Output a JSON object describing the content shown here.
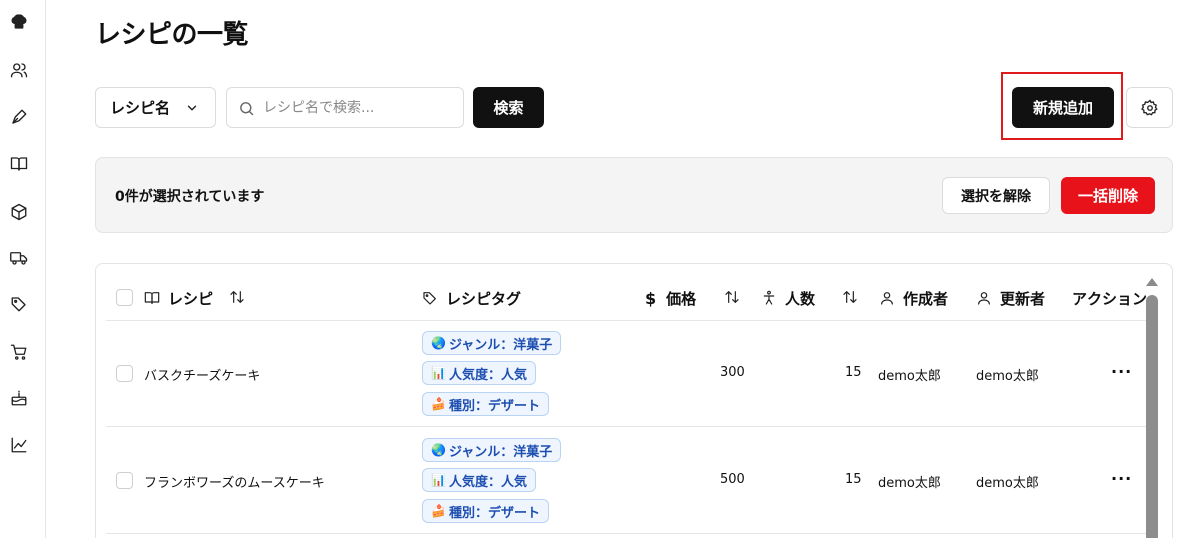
{
  "page": {
    "title": "レシピの一覧"
  },
  "sidebar": {
    "icons": [
      "chef-hat-icon",
      "users-icon",
      "pen-icon",
      "book-icon",
      "box-icon",
      "truck-icon",
      "tags-icon",
      "cart-icon",
      "cake-icon",
      "chart-icon"
    ]
  },
  "toolbar": {
    "filter_select": "レシピ名",
    "search_placeholder": "レシピ名で検索...",
    "search_button": "検索",
    "add_button": "新規追加"
  },
  "selection": {
    "count_text": "0件が選択されています",
    "clear_button": "選択を解除",
    "bulk_delete_button": "一括削除"
  },
  "table": {
    "columns": {
      "recipe": "レシピ",
      "tags": "レシピタグ",
      "price": "価格",
      "servings": "人数",
      "creator": "作成者",
      "updater": "更新者",
      "actions": "アクション"
    },
    "rows": [
      {
        "name": "バスクチーズケーキ",
        "tags": [
          {
            "emoji": "🌏",
            "label": "ジャンル：洋菓子"
          },
          {
            "emoji": "📊",
            "label": "人気度：人気"
          },
          {
            "emoji": "🍰",
            "label": "種別：デザート"
          }
        ],
        "price": "300",
        "servings": "15",
        "creator": "demo太郎",
        "updater": "demo太郎",
        "actions": "···"
      },
      {
        "name": "フランボワーズのムースケーキ",
        "tags": [
          {
            "emoji": "🌏",
            "label": "ジャンル：洋菓子"
          },
          {
            "emoji": "📊",
            "label": "人気度：人気"
          },
          {
            "emoji": "🍰",
            "label": "種別：デザート"
          }
        ],
        "price": "500",
        "servings": "15",
        "creator": "demo太郎",
        "updater": "demo太郎",
        "actions": "···"
      }
    ]
  }
}
